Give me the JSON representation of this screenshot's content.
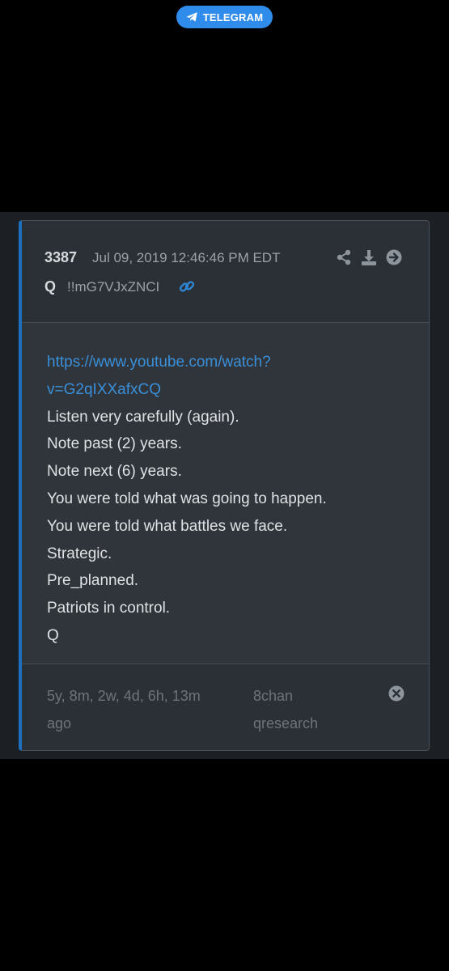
{
  "telegram": {
    "label": "TELEGRAM",
    "icon": "paper-plane-icon",
    "color": "#2f8cea"
  },
  "post": {
    "number": "3387",
    "date": "Jul 09, 2019 12:46:46 PM EDT",
    "author": "Q",
    "tripcode": "!!mG7VJxZNCI",
    "header_icons": [
      "share-icon",
      "download-icon",
      "arrow-right-circle-icon"
    ],
    "link_icon": "link-icon",
    "accent_color": "#1f6fbf",
    "link_color": "#3a8fd8",
    "body": {
      "url_line1": "https://www.youtube.com/watch?",
      "url_line2": "v=G2qIXXafxCQ",
      "lines": [
        "Listen very carefully (again).",
        "Note past (2) years.",
        "Note next (6) years.",
        "You were told what was going to happen.",
        "You were told what battles we face.",
        "Strategic.",
        "Pre_planned.",
        "Patriots in control.",
        "Q"
      ]
    },
    "footer": {
      "age_line1": "5y, 8m, 2w, 4d, 6h, 13m",
      "age_line2": "ago",
      "source_line1": "8chan",
      "source_line2": "qresearch",
      "close_icon": "close-circle-icon"
    }
  }
}
